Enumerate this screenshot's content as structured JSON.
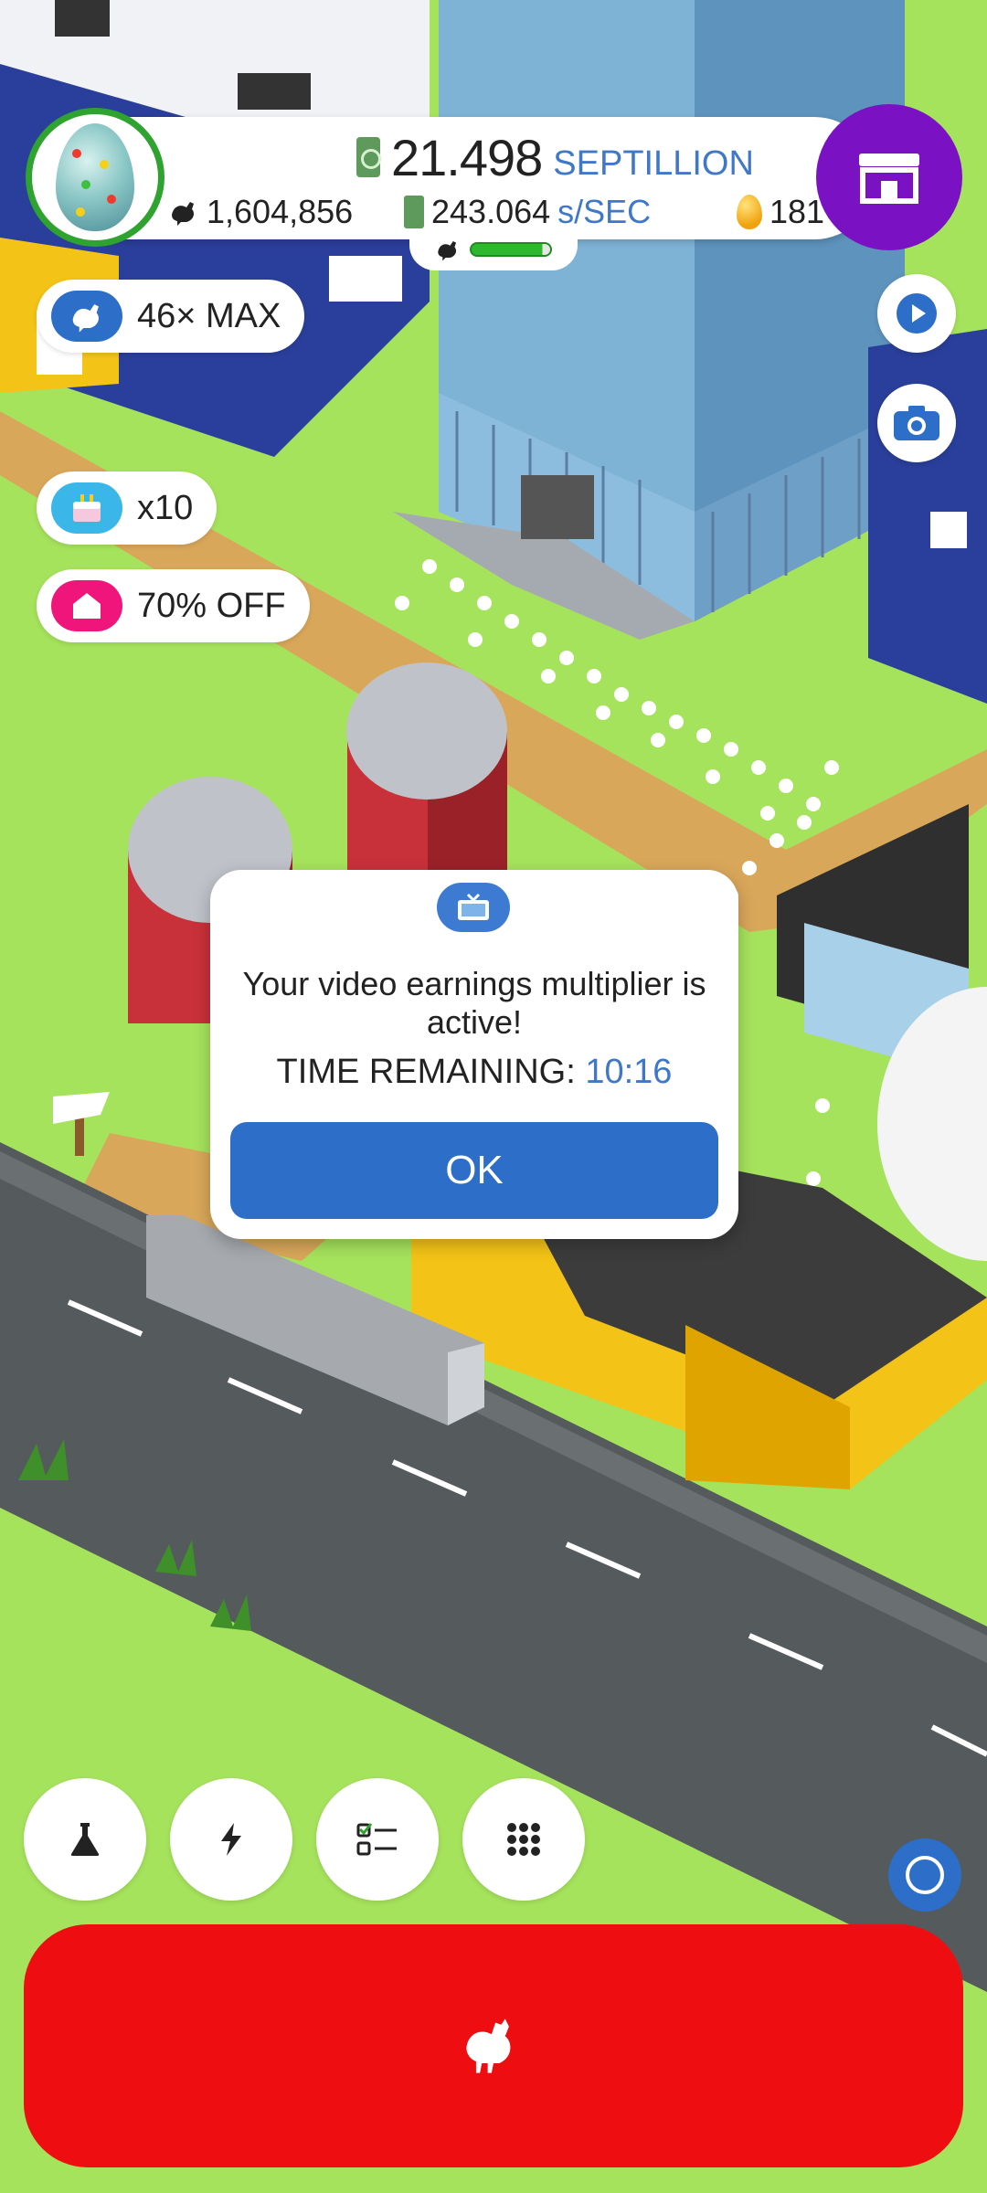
{
  "colors": {
    "grass": "#a6e35c",
    "accent_blue": "#3f78c7",
    "ok_blue": "#2c6ec8",
    "shop_purple": "#7a12c4",
    "hatch_red": "#ee0d10",
    "boost_blue": "#2c6ec8",
    "discount_pink": "#f0157a",
    "progress_green": "#2fb82f"
  },
  "hud": {
    "cash_value": "21.498",
    "cash_unit": "SEPTILLION",
    "chicken_count": "1,604,856",
    "rate_value": "243.064",
    "rate_unit": "s/SEC",
    "golden_eggs": "181",
    "hatch_progress": 0.9,
    "egg_icon": "enlightenment-egg-icon",
    "shop_icon": "shop-icon"
  },
  "pills": {
    "boost_label": "46× MAX",
    "boost_icon": "chicken-icon",
    "cake_label": "x10",
    "cake_icon": "cake-icon",
    "discount_label": "70% OFF",
    "discount_icon": "house-icon"
  },
  "right_buttons": {
    "video_icon": "play-icon",
    "camera_icon": "camera-icon"
  },
  "dialog": {
    "icon": "tv-icon",
    "message": "Your video earnings multiplier is active!",
    "time_label": "TIME REMAINING:",
    "time_value": "10:16",
    "ok_label": "OK"
  },
  "toolbar": {
    "research_icon": "flask-icon",
    "boosts_icon": "lightning-icon",
    "missions_icon": "checklist-icon",
    "menu_icon": "grid-icon",
    "assist_icon": "circle-icon",
    "hatch_icon": "chicken-icon"
  }
}
